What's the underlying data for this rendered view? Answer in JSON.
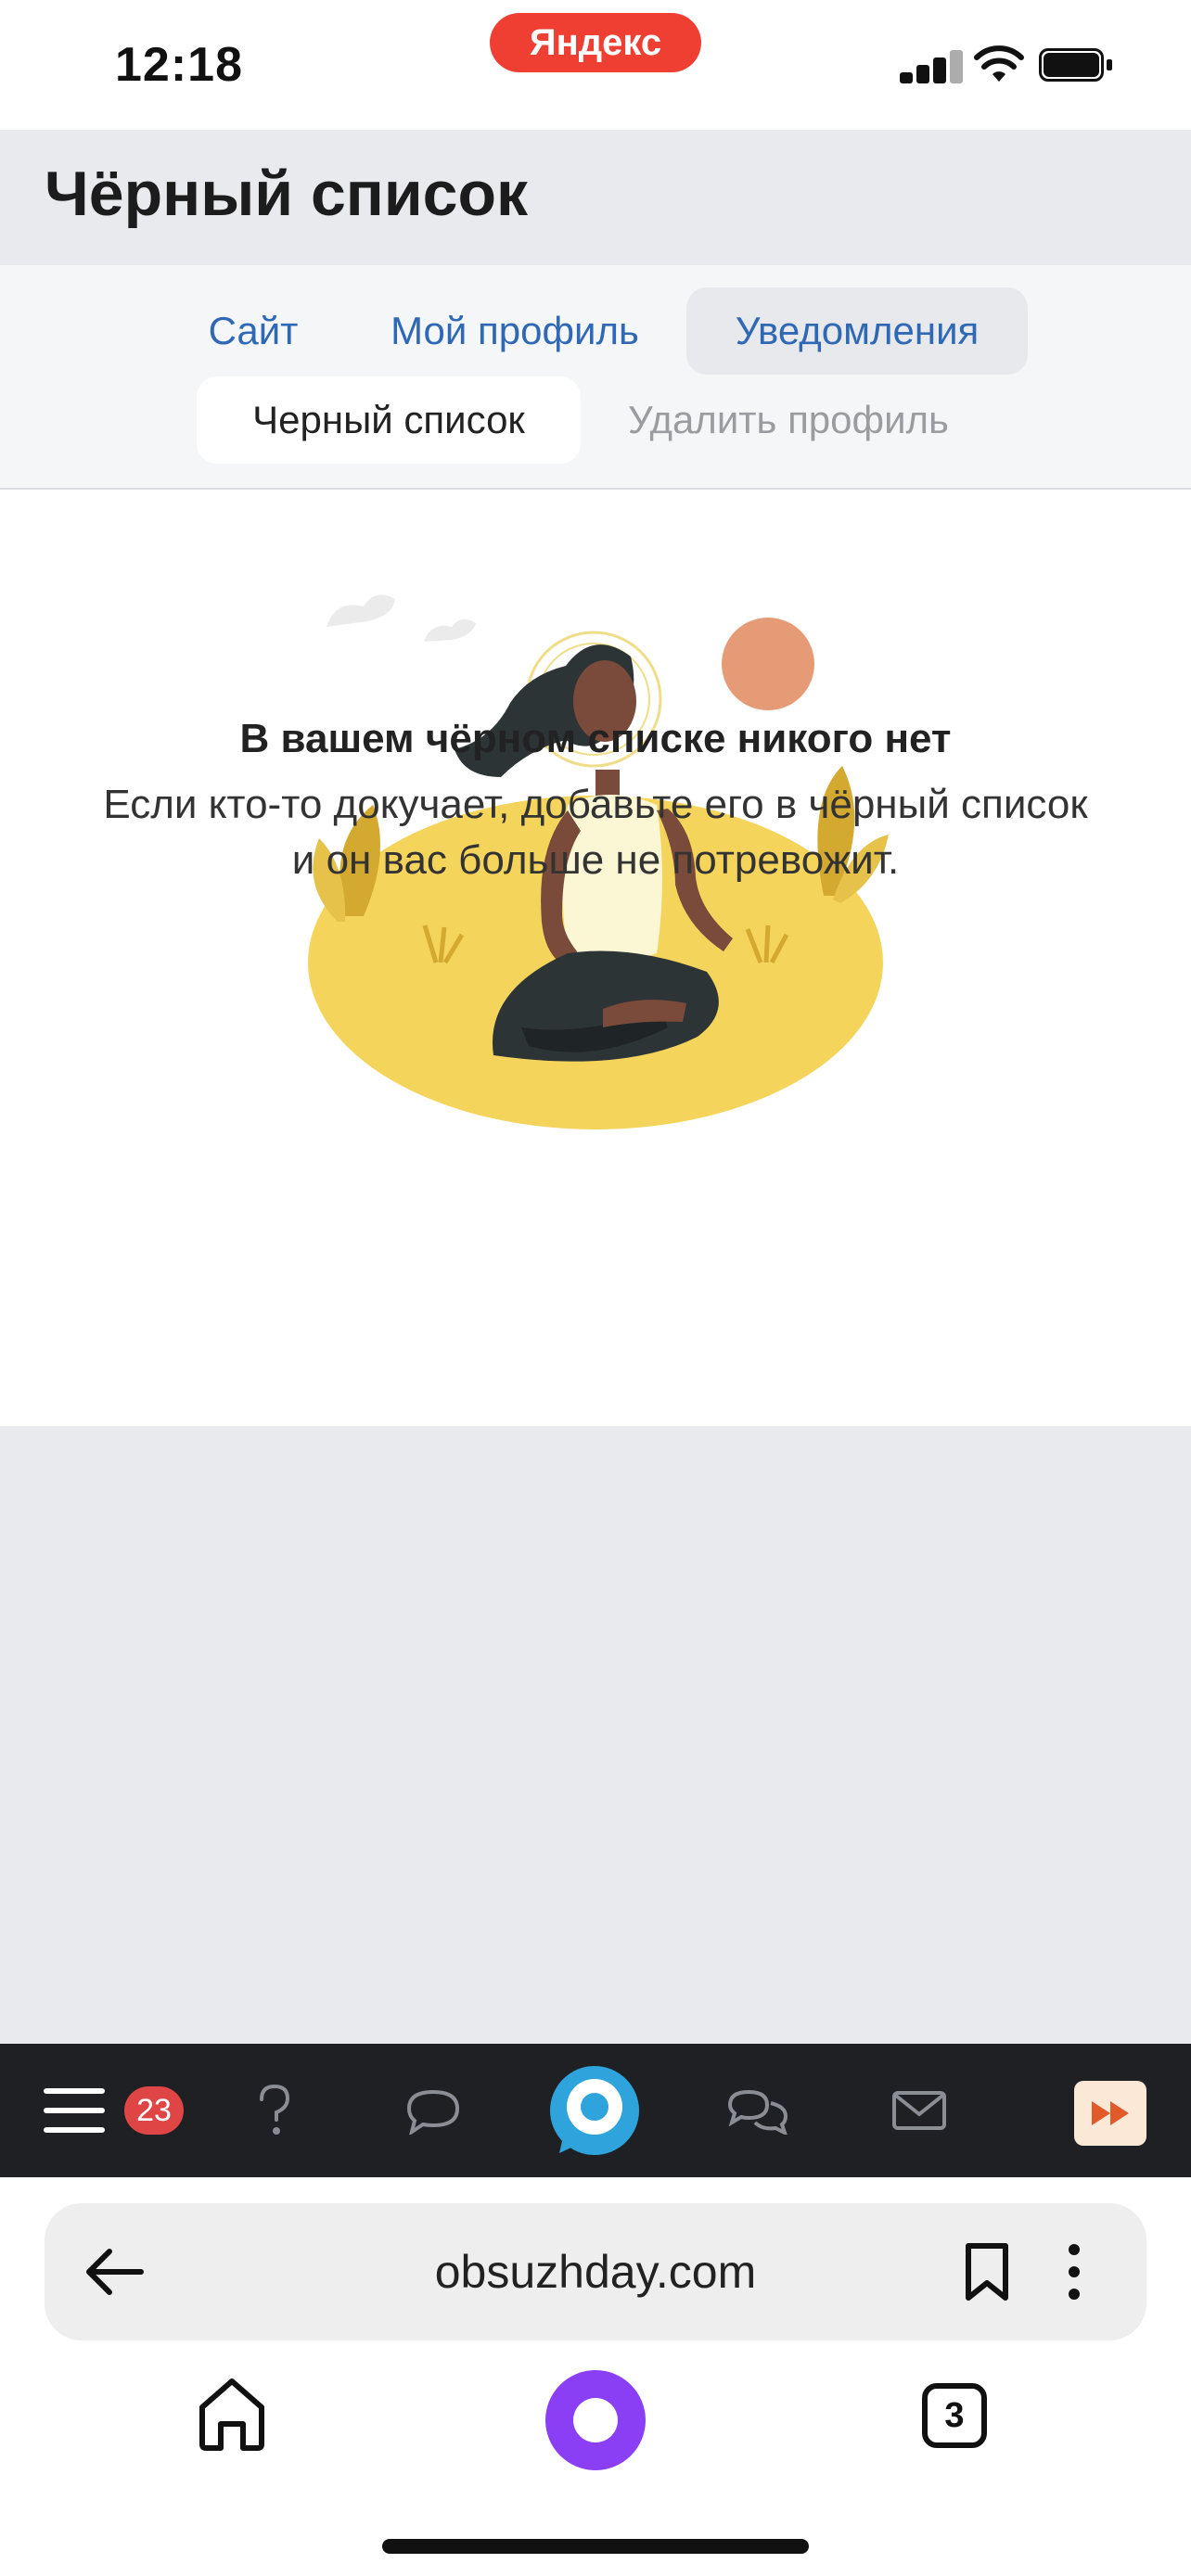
{
  "status_bar": {
    "time": "12:18",
    "app_pill": "Яндекс"
  },
  "header": {
    "title": "Чёрный список"
  },
  "tabs": [
    {
      "label": "Сайт",
      "state": "link"
    },
    {
      "label": "Мой профиль",
      "state": "link"
    },
    {
      "label": "Уведомления",
      "state": "link-highlighted"
    },
    {
      "label": "Черный список",
      "state": "active"
    },
    {
      "label": "Удалить профиль",
      "state": "muted"
    }
  ],
  "empty_state": {
    "illustration": "meditating-woman-illustration",
    "title": "В вашем чёрном списке никого нет",
    "text": "Если кто-то докучает, добавьте его в чёрный список и он вас больше не потревожит."
  },
  "site_nav": {
    "menu_badge": "23",
    "icons": [
      "menu-icon",
      "question-icon",
      "chat-bubble-icon",
      "logo-icon",
      "chats-icon",
      "mail-icon",
      "fast-forward-icon"
    ]
  },
  "browser": {
    "url": "obsuzhday.com",
    "tabs_count": "3"
  },
  "colors": {
    "accent_link": "#2f68b5",
    "badge_red": "#e04545",
    "yandex_red": "#ef3f33",
    "alice_purple": "#8b3ff5",
    "illustration_yellow": "#f5d45c"
  }
}
